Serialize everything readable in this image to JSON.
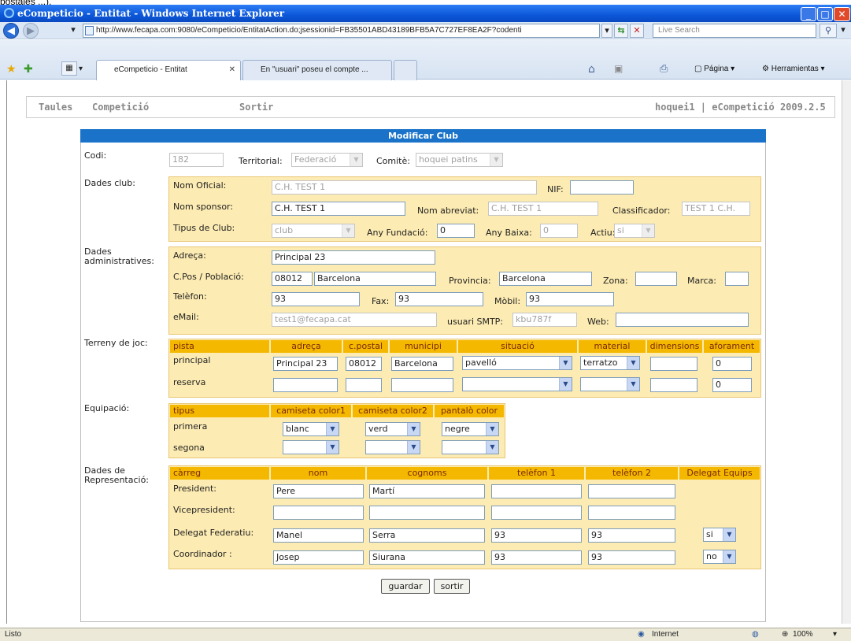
{
  "window": {
    "title": "eCompeticio - Entitat - Windows Internet Explorer"
  },
  "top_text": "postales ...).",
  "nav": {
    "url": "http://www.fecapa.com:9080/eCompeticio/EntitatAction.do;jsessionid=FB35501ABD43189BFB5A7C727EF8EA2F?codenti",
    "search_placeholder": "Live Search"
  },
  "tabs": [
    {
      "label": "eCompeticio - Entitat"
    },
    {
      "label": "En \"usuari\" poseu el compte ..."
    }
  ],
  "commands": {
    "page": "Página",
    "tools": "Herramientas"
  },
  "menu": {
    "items": [
      "Taules",
      "Competició",
      "Sortir"
    ],
    "right": "hoquei1 | eCompetició 2009.2.5"
  },
  "form": {
    "title": "Modificar Club",
    "codi": {
      "label": "Codi:",
      "value": "182"
    },
    "territorial": {
      "label": "Territorial:",
      "value": "Federació"
    },
    "comite": {
      "label": "Comitè:",
      "value": "hoquei patins"
    },
    "dades_club": {
      "section": "Dades club:",
      "nom_oficial_label": "Nom Oficial:",
      "nom_oficial": "C.H. TEST 1",
      "nif_label": "NIF:",
      "nif": "",
      "nom_sponsor_label": "Nom sponsor:",
      "nom_sponsor": "C.H. TEST 1",
      "nom_abreviat_label": "Nom abreviat:",
      "nom_abreviat": "C.H. TEST 1",
      "classificador_label": "Classificador:",
      "classificador": "TEST 1 C.H.",
      "tipus_label": "Tipus de Club:",
      "tipus": "club",
      "any_fundacio_label": "Any Fundació:",
      "any_fundacio": "0",
      "any_baixa_label": "Any Baixa:",
      "any_baixa": "0",
      "actiu_label": "Actiu:",
      "actiu": "si"
    },
    "dades_admin": {
      "section1": "Dades",
      "section2": "administratives:",
      "adreca_label": "Adreça:",
      "adreca": "Principal 23",
      "cpos_label": "C.Pos / Població:",
      "cpos": "08012",
      "poblacio": "Barcelona",
      "provincia_label": "Provincia:",
      "provincia": "Barcelona",
      "zona_label": "Zona:",
      "zona": "",
      "marca_label": "Marca:",
      "marca": "",
      "telefon_label": "Telèfon:",
      "telefon": "93",
      "fax_label": "Fax:",
      "fax": "93",
      "mobil_label": "Mòbil:",
      "mobil": "93",
      "email_label": "eMail:",
      "email": "test1@fecapa.cat",
      "smtp_label": "usuari SMTP:",
      "smtp": "kbu787f",
      "web_label": "Web:",
      "web": ""
    },
    "terreny": {
      "section": "Terreny de joc:",
      "headers": [
        "pista",
        "adreça",
        "c.postal",
        "municipi",
        "situació",
        "material",
        "dimensions",
        "aforament"
      ],
      "rows": [
        {
          "pista": "principal",
          "adreca": "Principal 23",
          "cpostal": "08012",
          "municipi": "Barcelona",
          "situacio": "pavelló",
          "material": "terratzo",
          "dimensions": "",
          "aforament": "0"
        },
        {
          "pista": "reserva",
          "adreca": "",
          "cpostal": "",
          "municipi": "",
          "situacio": "",
          "material": "",
          "dimensions": "",
          "aforament": "0"
        }
      ]
    },
    "equipacio": {
      "section": "Equipació:",
      "headers": [
        "tipus",
        "camiseta color1",
        "camiseta color2",
        "pantalò color"
      ],
      "rows": [
        {
          "tipus": "primera",
          "c1": "blanc",
          "c2": "verd",
          "p": "negre"
        },
        {
          "tipus": "segona",
          "c1": "",
          "c2": "",
          "p": ""
        }
      ]
    },
    "representacio": {
      "section1": "Dades de",
      "section2": "Representació:",
      "headers": [
        "càrreg",
        "nom",
        "cognoms",
        "telèfon 1",
        "telèfon 2",
        "Delegat Equips"
      ],
      "rows": [
        {
          "carreg": "President:",
          "nom": "Pere",
          "cognoms": "Martí",
          "t1": "",
          "t2": "",
          "delegat": ""
        },
        {
          "carreg": "Vicepresident:",
          "nom": "",
          "cognoms": "",
          "t1": "",
          "t2": "",
          "delegat": ""
        },
        {
          "carreg": "Delegat Federatiu:",
          "nom": "Manel",
          "cognoms": "Serra",
          "t1": "93",
          "t2": "93",
          "delegat": "si"
        },
        {
          "carreg": "Coordinador :",
          "nom": "Josep",
          "cognoms": "Siurana",
          "t1": "93",
          "t2": "93",
          "delegat": "no"
        }
      ]
    },
    "buttons": {
      "guardar": "guardar",
      "sortir": "sortir"
    }
  },
  "status": {
    "text": "Listo",
    "zone": "Internet",
    "zoom": "100%"
  }
}
